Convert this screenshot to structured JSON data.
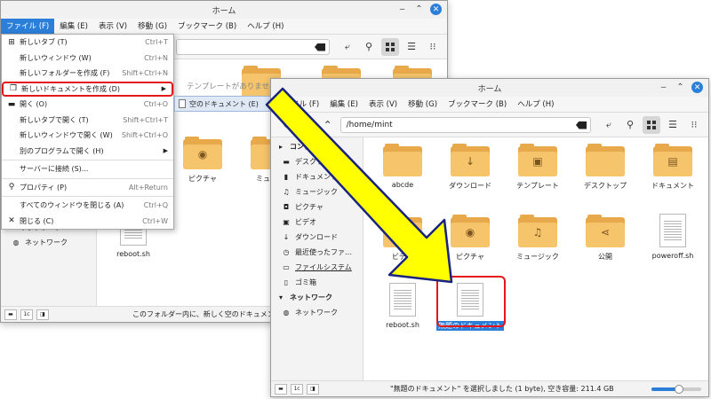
{
  "back_window": {
    "title": "ホーム",
    "menu": [
      "ファイル (F)",
      "編集 (E)",
      "表示 (V)",
      "移動 (G)",
      "ブックマーク (B)",
      "ヘルプ (H)"
    ],
    "file_menu": [
      {
        "icon": "+",
        "label": "新しいタブ (T)",
        "shortcut": "Ctrl+T"
      },
      {
        "icon": "",
        "label": "新しいウィンドウ (W)",
        "shortcut": "Ctrl+N"
      },
      {
        "icon": "",
        "label": "新しいフォルダーを作成 (F)",
        "shortcut": "Shift+Ctrl+N"
      },
      {
        "icon": "❐",
        "label": "新しいドキュメントを作成 (D)",
        "shortcut": ""
      },
      {
        "icon": "▬",
        "label": "開く (O)",
        "shortcut": "Ctrl+O"
      },
      {
        "icon": "",
        "label": "新しいタブで開く (T)",
        "shortcut": "Shift+Ctrl+T"
      },
      {
        "icon": "",
        "label": "新しいウィンドウで開く (W)",
        "shortcut": "Shift+Ctrl+O"
      },
      {
        "icon": "",
        "label": "別のプログラムで開く (H)",
        "shortcut": ""
      },
      {
        "icon": "",
        "label": "サーバーに接続 (S)...",
        "shortcut": ""
      },
      {
        "icon": "Q",
        "label": "プロパティ (P)",
        "shortcut": "Alt+Return"
      },
      {
        "icon": "",
        "label": "すべてのウィンドウを閉じる (A)",
        "shortcut": "Ctrl+Q"
      },
      {
        "icon": "×",
        "label": "閉じる (C)",
        "shortcut": "Ctrl+W"
      }
    ],
    "submenu_item": "空のドキュメント (E)",
    "no_template_text": "テンプレートがありませ…",
    "sidebar_network": "ネットワーク",
    "sidebar_network_item": "ネットワーク",
    "visible_files": [
      {
        "name": "ピクチャ",
        "type": "folder"
      },
      {
        "name": "ミュー…",
        "type": "folder"
      },
      {
        "name": "reboot.sh",
        "type": "doc"
      }
    ],
    "status_text": "このフォルダー内に、新しく空のドキュメント…"
  },
  "front_window": {
    "title": "ホーム",
    "menu": [
      "ファイル (F)",
      "編集 (E)",
      "表示 (V)",
      "移動 (G)",
      "ブックマーク (B)",
      "ヘルプ (H)"
    ],
    "path": "/home/mint",
    "sidebar": [
      {
        "icon": "▸",
        "label": "コンピューター",
        "head": true
      },
      {
        "icon": "▬",
        "label": "デスクトップ"
      },
      {
        "icon": "▮",
        "label": "ドキュメント"
      },
      {
        "icon": "♫",
        "label": "ミュージック"
      },
      {
        "icon": "◘",
        "label": "ピクチャ"
      },
      {
        "icon": "▣",
        "label": "ビデオ"
      },
      {
        "icon": "↓",
        "label": "ダウンロード"
      },
      {
        "icon": "◷",
        "label": "最近使ったファ…"
      },
      {
        "icon": "▭",
        "label": "ファイルシステム",
        "underline": true
      },
      {
        "icon": "▯",
        "label": "ゴミ箱"
      },
      {
        "icon": "▾",
        "label": "ネットワーク",
        "head": true
      },
      {
        "icon": "◍",
        "label": "ネットワーク"
      }
    ],
    "files": [
      {
        "name": "abcde",
        "type": "folder",
        "emblem": ""
      },
      {
        "name": "ダウンロード",
        "type": "folder",
        "emblem": "↓"
      },
      {
        "name": "テンプレート",
        "type": "folder",
        "emblem": "▣"
      },
      {
        "name": "デスクトップ",
        "type": "folder",
        "emblem": ""
      },
      {
        "name": "ドキュメント",
        "type": "folder",
        "emblem": "▤"
      },
      {
        "name": "ビデオ",
        "type": "folder",
        "emblem": "▦"
      },
      {
        "name": "ピクチャ",
        "type": "folder",
        "emblem": "◉"
      },
      {
        "name": "ミュージック",
        "type": "folder",
        "emblem": "♫"
      },
      {
        "name": "公開",
        "type": "folder",
        "emblem": "⋖"
      },
      {
        "name": "poweroff.sh",
        "type": "doc"
      },
      {
        "name": "reboot.sh",
        "type": "doc"
      },
      {
        "name": "無題のドキュメント",
        "type": "doc",
        "selected": true
      }
    ],
    "status_text": "\"無題のドキュメント\" を選択しました (1 byte), 空き容量: 211.4 GB",
    "zoom_level": 0.55
  },
  "colors": {
    "accent": "#2c7fd8",
    "highlight_red": "#e4161a",
    "arrow_fill": "#ffff00",
    "folder": "#f5c46b"
  }
}
